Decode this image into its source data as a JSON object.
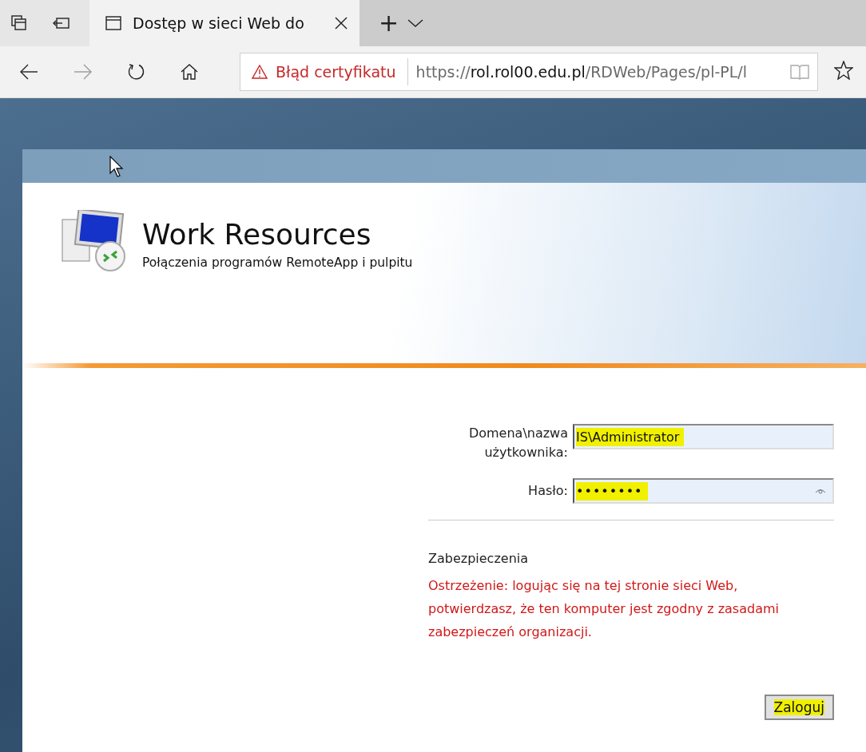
{
  "browser": {
    "tabs": [
      {
        "title": "Dostęp w sieci Web do",
        "selected": true
      }
    ],
    "new_tab": "+",
    "address_bar": {
      "warning": "Błąd certyfikatu",
      "url_scheme": "https://",
      "url_host": "rol.rol00.edu.pl",
      "url_path": "/RDWeb/Pages/pl-PL/l"
    }
  },
  "page": {
    "title": "Work Resources",
    "subtitle": "Połączenia programów RemoteApp i pulpitu",
    "fields": [
      {
        "kind": "text",
        "label": "Domena\\nazwa użytkownika:",
        "value": "IS\\Administrator",
        "highlighted": true
      },
      {
        "kind": "password",
        "label": "Hasło:",
        "value": "••••••••",
        "highlighted": true
      }
    ],
    "security_heading": "Zabezpieczenia",
    "warning": "Ostrzeżenie: logując się na tej stronie sieci Web, potwierdzasz, że ten komputer jest zgodny z zasadami zabezpieczeń organizacji.",
    "login_button": {
      "label": "Zaloguj",
      "highlighted": true
    }
  }
}
